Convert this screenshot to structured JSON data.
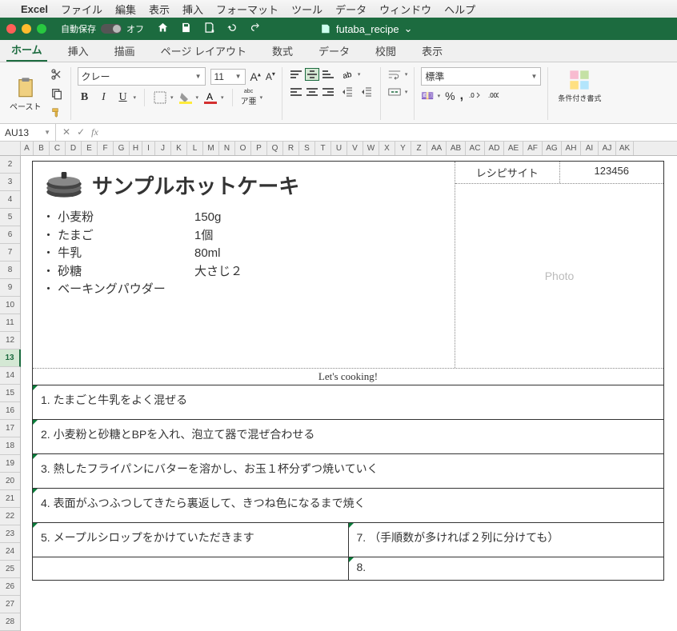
{
  "mac_menu": {
    "app": "Excel",
    "items": [
      "ファイル",
      "編集",
      "表示",
      "挿入",
      "フォーマット",
      "ツール",
      "データ",
      "ウィンドウ",
      "ヘルプ"
    ]
  },
  "titlebar": {
    "autosave_label": "自動保存",
    "autosave_state": "オフ",
    "document": "futaba_recipe",
    "chev": "⌄"
  },
  "ribbon_tabs": [
    "ホーム",
    "挿入",
    "描画",
    "ページ レイアウト",
    "数式",
    "データ",
    "校閲",
    "表示"
  ],
  "ribbon": {
    "paste_label": "ペースト",
    "font_name": "クレー",
    "font_size": "11",
    "number_format": "標準",
    "cond_fmt": "条件付き書式"
  },
  "formula": {
    "name_box": "AU13",
    "value": ""
  },
  "columns": [
    "A",
    "B",
    "C",
    "D",
    "E",
    "F",
    "G",
    "H",
    "I",
    "J",
    "K",
    "L",
    "M",
    "N",
    "O",
    "P",
    "Q",
    "R",
    "S",
    "T",
    "U",
    "V",
    "W",
    "X",
    "Y",
    "Z",
    "AA",
    "AB",
    "AC",
    "AD",
    "AE",
    "AF",
    "AG",
    "AH",
    "AI",
    "AJ",
    "AK"
  ],
  "rows": [
    "2",
    "3",
    "4",
    "5",
    "6",
    "7",
    "8",
    "9",
    "10",
    "11",
    "12",
    "13",
    "14",
    "15",
    "16",
    "17",
    "18",
    "19",
    "20",
    "21",
    "22",
    "23",
    "24",
    "25",
    "26",
    "27",
    "28"
  ],
  "selected_row": "13",
  "recipe": {
    "title": "サンプルホットケーキ",
    "meta_label": "レシピサイト",
    "meta_id": "123456",
    "photo_placeholder": "Photo",
    "cooking": "Let's cooking!",
    "ingredients": [
      {
        "name": "・ 小麦粉",
        "amount": "150g"
      },
      {
        "name": "・ たまご",
        "amount": "1個"
      },
      {
        "name": "・ 牛乳",
        "amount": "80ml"
      },
      {
        "name": "・ 砂糖",
        "amount": "大さじ２"
      },
      {
        "name": "・ ベーキングパウダー",
        "amount": ""
      }
    ],
    "steps1": "1.   たまごと牛乳をよく混ぜる",
    "steps2": "2.   小麦粉と砂糖とBPを入れ、泡立て器で混ぜ合わせる",
    "steps3": "3.   熱したフライパンにバターを溶かし、お玉１杯分ずつ焼いていく",
    "steps4": "4.   表面がふつふつしてきたら裏返して、きつね色になるまで焼く",
    "steps5": "5.   メープルシロップをかけていただきます",
    "steps7": "7.   （手順数が多ければ２列に分けても）",
    "steps8": "8."
  }
}
